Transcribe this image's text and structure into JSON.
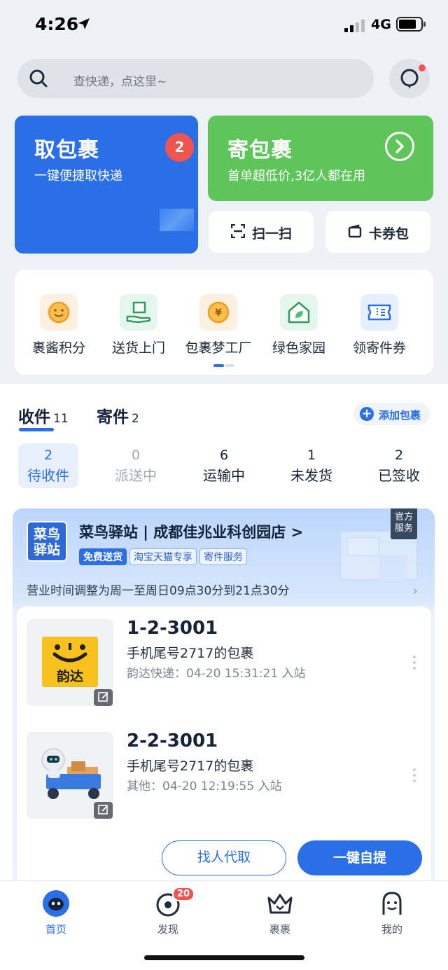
{
  "status_bar": {
    "time": "4:26",
    "network": "4G"
  },
  "search": {
    "placeholder": "查快递，点这里~"
  },
  "pickup_card": {
    "title": "取包裹",
    "subtitle": "一键便捷取快递",
    "count": "2"
  },
  "send_card": {
    "title": "寄包裹",
    "subtitle": "首单超低价,3亿人都在用"
  },
  "quick_buttons": [
    {
      "label": "扫一扫",
      "icon": "scan-icon"
    },
    {
      "label": "卡券包",
      "icon": "wallet-icon"
    }
  ],
  "services": [
    {
      "label": "裹酱积分",
      "icon": "smile-icon",
      "color": "#f5a623"
    },
    {
      "label": "送货上门",
      "icon": "hand-box-icon",
      "color": "#3cb371"
    },
    {
      "label": "包裹梦工厂",
      "icon": "coin-icon",
      "color": "#f5a623"
    },
    {
      "label": "绿色家园",
      "icon": "leaf-house-icon",
      "color": "#3cb371"
    },
    {
      "label": "领寄件券",
      "icon": "coupon-icon",
      "color": "#2a6ee8"
    }
  ],
  "package_tabs": [
    {
      "label": "收件",
      "count": "11"
    },
    {
      "label": "寄件",
      "count": "2"
    }
  ],
  "add_package_label": "添加包裹",
  "stats": [
    {
      "value": "2",
      "label": "待收件"
    },
    {
      "value": "0",
      "label": "派送中"
    },
    {
      "value": "6",
      "label": "运输中"
    },
    {
      "value": "1",
      "label": "未发货"
    },
    {
      "value": "2",
      "label": "已签收"
    }
  ],
  "station": {
    "logo_line1": "菜鸟",
    "logo_line2": "驿站",
    "name": "菜鸟驿站 | 成都佳兆业科创园店 >",
    "tags": [
      "免费送货",
      "淘宝天猫专享",
      "寄件服务"
    ],
    "official_line1": "官方",
    "official_line2": "服务",
    "notice": "营业时间调整为周一至周日09点30分到21点30分"
  },
  "packages": [
    {
      "code": "1-2-3001",
      "desc": "手机尾号2717的包裹",
      "meta": "韵达快递：04-20 15:31:21 入站",
      "carrier_logo": "韵达"
    },
    {
      "code": "2-2-3001",
      "desc": "手机尾号2717的包裹",
      "meta": "其他：04-20 12:19:55 入站"
    }
  ],
  "actions": {
    "agent": "找人代取",
    "self_pickup": "一键自提"
  },
  "tabbar": [
    {
      "label": "首页",
      "icon": "home-mascot-icon"
    },
    {
      "label": "发现",
      "icon": "discover-eye-icon",
      "badge": "20"
    },
    {
      "label": "裹裹",
      "icon": "crown-icon"
    },
    {
      "label": "我的",
      "icon": "profile-icon"
    }
  ]
}
